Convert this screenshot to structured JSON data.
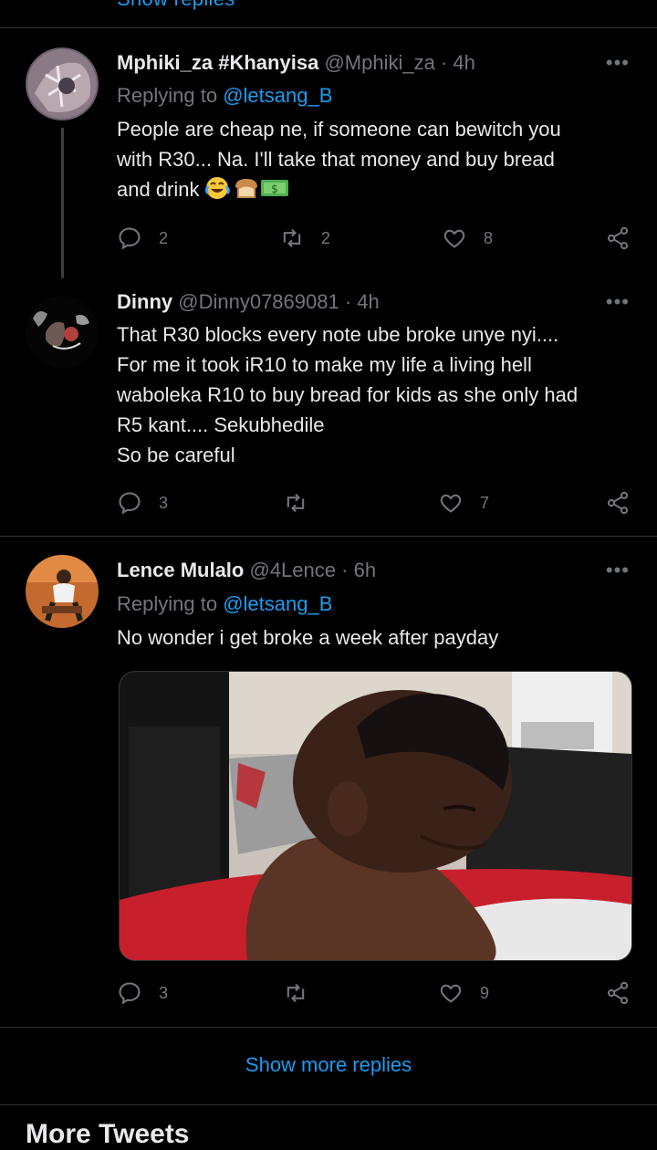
{
  "top_link": "Show replies",
  "tweets": [
    {
      "name": "Mphiki_za #Khanyisa",
      "handle": "@Mphiki_za",
      "time": "4h",
      "replying_label": "Replying to",
      "replying_handle": "@letsang_B",
      "text": "People are cheap ne, if someone can bewitch you\nwith R30... Na. I'll take that money and buy bread\nand drink",
      "emojis": [
        "joy-emoji",
        "bread-emoji",
        "money-emoji"
      ],
      "reply_count": "2",
      "retweet_count": "2",
      "like_count": "8"
    },
    {
      "name": "Dinny",
      "handle": "@Dinny07869081",
      "time": "4h",
      "text": "That R30 blocks every note ube broke unye nyi....\nFor me it took iR10 to make my life a living hell\nwaboleka R10 to buy bread for kids as she only had\nR5 kant.... Sekubhedile\nSo be careful",
      "reply_count": "3",
      "retweet_count": "",
      "like_count": "7"
    },
    {
      "name": "Lence Mulalo",
      "handle": "@4Lence",
      "time": "6h",
      "replying_label": "Replying to",
      "replying_handle": "@letsang_B",
      "text": "No wonder i get broke a week after payday",
      "reply_count": "3",
      "retweet_count": "",
      "like_count": "9"
    }
  ],
  "separator": "·",
  "show_more_replies": "Show more replies",
  "section_title": "More Tweets",
  "colors": {
    "accent": "#1d9bf0",
    "background": "#000000",
    "muted": "#71767b"
  }
}
